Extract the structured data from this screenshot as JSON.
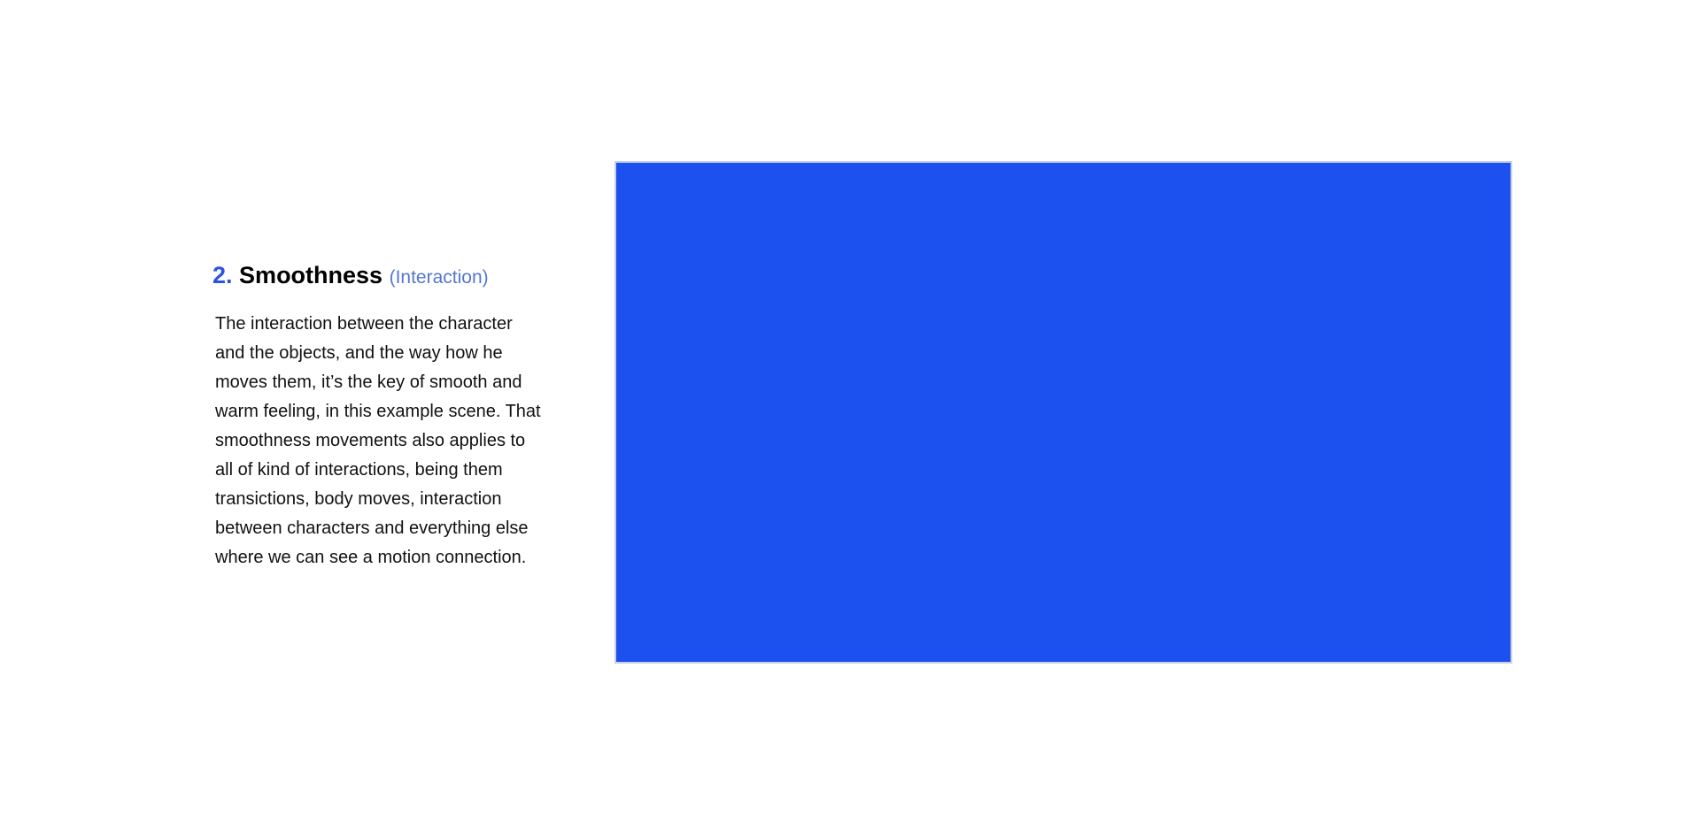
{
  "section": {
    "number": "2.",
    "title": "Smoothness",
    "subtitle": "(Interaction)",
    "body": "The interaction between the character and the objects, and the way how he moves them, it’s the key of smooth and warm feeling, in this example scene. That smoothness movements also applies to all of kind of interactions, being them transictions, body moves, interaction between characters and everything else where we can see a motion connection."
  },
  "colors": {
    "accent": "#2a55e0",
    "subtitle": "#5577cc",
    "media_fill": "#1c50ef"
  }
}
